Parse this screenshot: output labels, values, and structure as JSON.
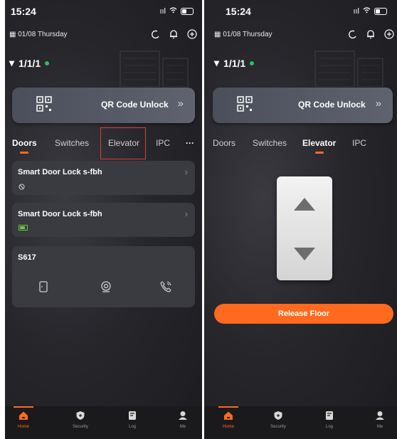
{
  "status_bar": {
    "time": "15:24",
    "signal": ""
  },
  "header": {
    "date": "01/08 Thursday",
    "unit": "1/1/1"
  },
  "qr": {
    "label": "QR Code Unlock",
    "arrow": "»"
  },
  "tabs": [
    "Doors",
    "Switches",
    "Elevator",
    "IPC",
    "···"
  ],
  "devices": [
    {
      "name": "Smart Door Lock s-fbh",
      "status_icon": "lock-unlinked-icon"
    },
    {
      "name": "Smart Door Lock s-fbh",
      "status_icon": "battery-icon"
    },
    {
      "name": "S617",
      "actions": [
        "door-icon",
        "camera-icon",
        "phone-call-icon"
      ]
    }
  ],
  "elevator": {
    "release_label": "Release Floor"
  },
  "nav": [
    {
      "label": "Home",
      "icon": "home-icon"
    },
    {
      "label": "Security",
      "icon": "shield-icon"
    },
    {
      "label": "Log",
      "icon": "log-icon"
    },
    {
      "label": "Me",
      "icon": "user-icon"
    }
  ],
  "colors": {
    "accent": "#ff6a1f",
    "online": "#22c35a",
    "highlight_box": "#e03a3a"
  }
}
